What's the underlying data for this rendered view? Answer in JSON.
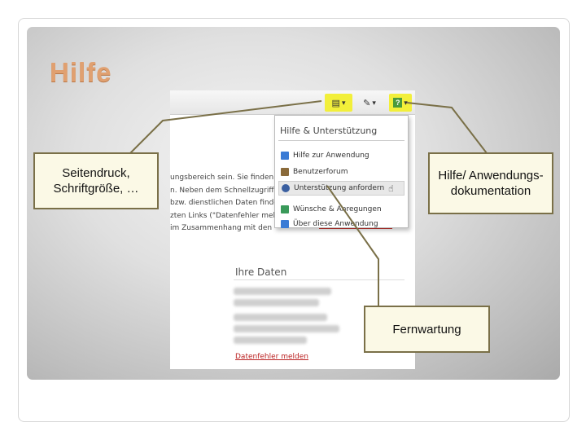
{
  "slide": {
    "title": "Hilfe",
    "title_color": "#e0a070"
  },
  "app": {
    "toolbar": {
      "print_icon": "print-settings-icon",
      "tools_icon": "tools-icon",
      "help_button_label": "?",
      "dropdown_glyph": "▾",
      "highlight_color": "#f2ef3a"
    },
    "help_menu": {
      "title": "Hilfe & Unterstützung",
      "items": [
        {
          "label": "Hilfe zur Anwendung",
          "icon": "help-icon",
          "color": "#3a7bd5"
        },
        {
          "label": "Benutzerforum",
          "icon": "forum-icon",
          "color": "#8a6a3a"
        },
        {
          "label": "Unterstützung anfordern",
          "icon": "support-person-icon",
          "color": "#3a5fa0"
        },
        {
          "label": "Wünsche & Anregungen",
          "icon": "suggestion-icon",
          "color": "#3a9a5a"
        },
        {
          "label": "Über diese Anwendung",
          "icon": "info-icon",
          "color": "#3a7bd5"
        }
      ]
    },
    "body_lines": [
      "ungsbereich sein. Sie finden auf",
      "n. Neben dem Schnellzugriff hab",
      "bzw. dienstlichen Daten finden S",
      "zten Links (\"Datenfehler melden\")",
      "im Zusammenhang mit den"
    ],
    "section_title": "Ihre Daten",
    "data_link": "Datenfehler melden"
  },
  "callouts": {
    "left": "Seitendruck, Schriftgröße, …",
    "right": "Hilfe/ Anwendungs-dokumentation",
    "bottom": "Fernwartung"
  }
}
